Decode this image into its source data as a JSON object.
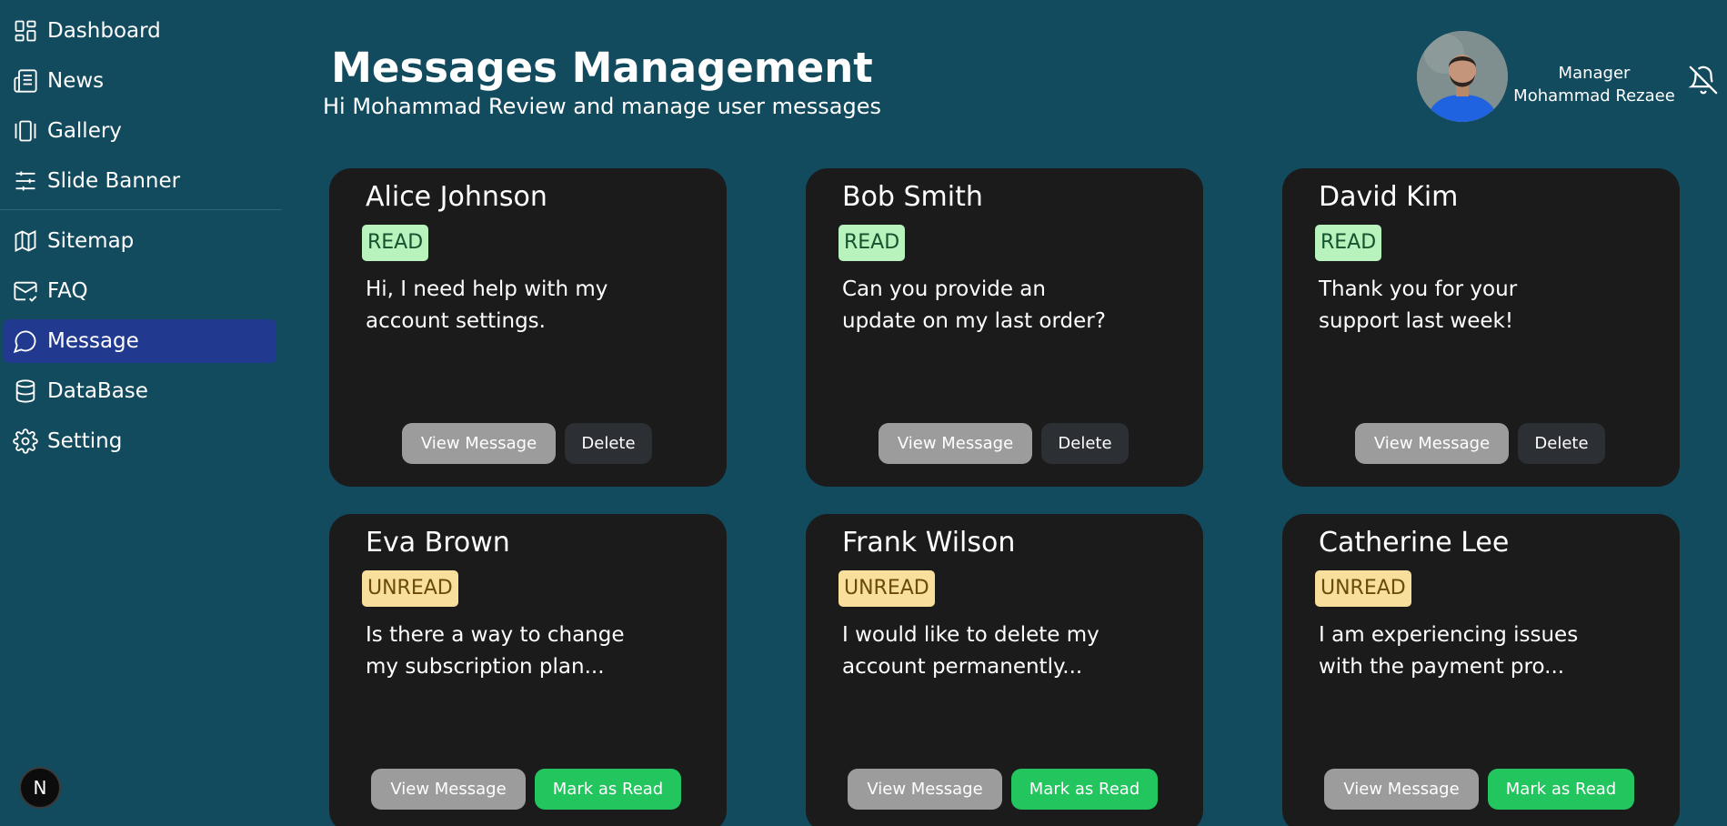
{
  "sidebar": {
    "items": [
      {
        "label": "Dashboard",
        "icon": "grid-icon"
      },
      {
        "label": "News",
        "icon": "newspaper-icon"
      },
      {
        "label": "Gallery",
        "icon": "gallery-icon"
      },
      {
        "label": "Slide Banner",
        "icon": "sliders-icon"
      },
      {
        "label": "Sitemap",
        "icon": "map-icon"
      },
      {
        "label": "FAQ",
        "icon": "mail-check-icon"
      },
      {
        "label": "Message",
        "icon": "message-circle-icon",
        "active": true
      },
      {
        "label": "DataBase",
        "icon": "database-icon"
      },
      {
        "label": "Setting",
        "icon": "gear-icon"
      }
    ],
    "logo_letter": "N"
  },
  "header": {
    "title": "Messages Management",
    "subtitle": "Hi Mohammad Review and manage user messages",
    "user_role": "Manager",
    "user_name": "Mohammad Rezaee"
  },
  "cards": [
    {
      "name": "Alice Johnson",
      "status": "READ",
      "message": "Hi, I need help with my account settings.",
      "view_label": "View Message",
      "action_label": "Delete"
    },
    {
      "name": "Bob Smith",
      "status": "READ",
      "message": "Can you provide an update on my last order?",
      "view_label": "View Message",
      "action_label": "Delete"
    },
    {
      "name": "David Kim",
      "status": "READ",
      "message": "Thank you for your support last week!",
      "view_label": "View Message",
      "action_label": "Delete"
    },
    {
      "name": "Eva Brown",
      "status": "UNREAD",
      "message": "Is there a way to change my subscription plan...",
      "view_label": "View Message",
      "action_label": "Mark as Read"
    },
    {
      "name": "Frank Wilson",
      "status": "UNREAD",
      "message": "I would like to delete my account permanently...",
      "view_label": "View Message",
      "action_label": "Mark as Read"
    },
    {
      "name": "Catherine Lee",
      "status": "UNREAD",
      "message": "I am experiencing issues with the payment pro...",
      "view_label": "View Message",
      "action_label": "Mark as Read"
    }
  ],
  "colors": {
    "background": "#124a5e",
    "card": "#1b1b1b",
    "active_nav": "#213a8f",
    "read_badge": "#b8f2bd",
    "unread_badge": "#f8df9b",
    "mark_read_button": "#22c55e"
  }
}
